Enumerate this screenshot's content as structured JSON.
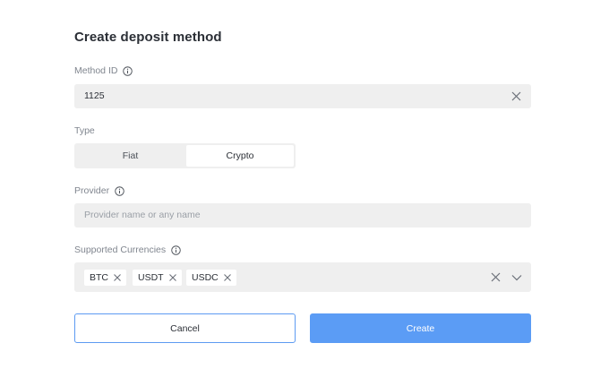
{
  "dialog": {
    "title": "Create deposit method"
  },
  "method_id": {
    "label": "Method ID",
    "value": "1125"
  },
  "type": {
    "label": "Type",
    "options": [
      "Fiat",
      "Crypto"
    ],
    "selected": "Crypto"
  },
  "provider": {
    "label": "Provider",
    "placeholder": "Provider name or any name",
    "value": ""
  },
  "currencies": {
    "label": "Supported Currencies",
    "selected": [
      "BTC",
      "USDT",
      "USDC"
    ]
  },
  "actions": {
    "cancel_label": "Cancel",
    "create_label": "Create"
  },
  "colors": {
    "accent": "#5b9cf5",
    "field_bg": "#efefef",
    "label": "#80868f"
  },
  "icons": {
    "info": "info-icon",
    "clear": "close-icon",
    "dropdown": "chevron-down-icon"
  }
}
